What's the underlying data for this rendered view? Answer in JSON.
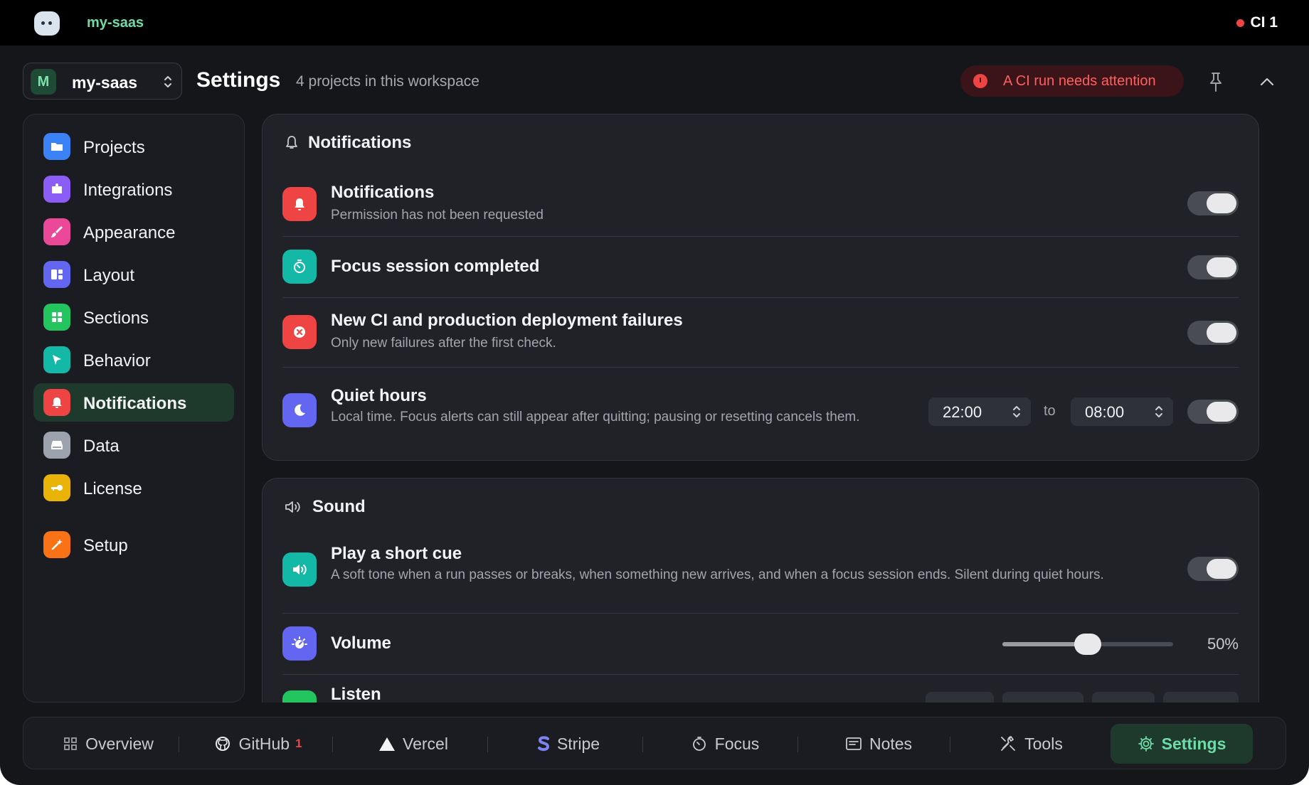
{
  "app": {
    "name": "my-saas",
    "ci_status": "CI 1"
  },
  "header": {
    "workspace_initial": "M",
    "workspace_name": "my-saas",
    "title": "Settings",
    "subtitle": "4 projects in this workspace",
    "alert_text": "A CI run needs attention"
  },
  "sidebar": {
    "items": [
      {
        "label": "Projects",
        "color": "#3b82f6",
        "icon": "folder-icon"
      },
      {
        "label": "Integrations",
        "color": "#8b5cf6",
        "icon": "puzzle-icon"
      },
      {
        "label": "Appearance",
        "color": "#ec4899",
        "icon": "brush-icon"
      },
      {
        "label": "Layout",
        "color": "#6366f1",
        "icon": "layout-icon"
      },
      {
        "label": "Sections",
        "color": "#22c55e",
        "icon": "grid-icon"
      },
      {
        "label": "Behavior",
        "color": "#14b8a6",
        "icon": "cursor-icon"
      },
      {
        "label": "Notifications",
        "color": "#ef4444",
        "icon": "bell-icon",
        "active": true
      },
      {
        "label": "Data",
        "color": "#9ca3af",
        "icon": "drive-icon"
      },
      {
        "label": "License",
        "color": "#eab308",
        "icon": "key-icon"
      },
      {
        "label": "Setup",
        "color": "#f97316",
        "icon": "wand-icon"
      }
    ]
  },
  "notifications_card": {
    "title": "Notifications",
    "rows": [
      {
        "title": "Notifications",
        "description": "Permission has not been requested",
        "color": "#ef4444",
        "icon": "bell-icon",
        "enabled": true
      },
      {
        "title": "Focus session completed",
        "description": "",
        "color": "#14b8a6",
        "icon": "timer-icon",
        "enabled": true
      },
      {
        "title": "New CI and production deployment failures",
        "description": "Only new failures after the first check.",
        "color": "#ef4444",
        "icon": "error-icon",
        "enabled": true
      },
      {
        "title": "Quiet hours",
        "description": "Local time. Focus alerts can still appear after quitting; pausing or resetting cancels them.",
        "color": "#6366f1",
        "icon": "moon-icon",
        "enabled": true
      }
    ],
    "quiet_hours": {
      "start": "22:00",
      "to_label": "to",
      "end": "08:00"
    }
  },
  "sound_card": {
    "title": "Sound",
    "rows": [
      {
        "title": "Play a short cue",
        "description": "A soft tone when a run passes or breaks, when something new arrives, and when a focus session ends. Silent during quiet hours.",
        "color": "#14b8a6",
        "icon": "speaker-icon",
        "enabled": true
      },
      {
        "title": "Volume",
        "color": "#6366f1",
        "icon": "dial-icon"
      },
      {
        "title": "Listen",
        "color": "#22c55e",
        "icon": "play-icon"
      }
    ],
    "volume": {
      "value": 0.5,
      "label": "50%"
    }
  },
  "tabs": [
    {
      "label": "Overview",
      "icon": "grid-icon"
    },
    {
      "label": "GitHub",
      "icon": "github-icon",
      "count": "1"
    },
    {
      "label": "Vercel",
      "icon": "triangle-icon"
    },
    {
      "label": "Stripe",
      "icon": "stripe-icon"
    },
    {
      "label": "Focus",
      "icon": "timer-icon"
    },
    {
      "label": "Notes",
      "icon": "notes-icon"
    },
    {
      "label": "Tools",
      "icon": "tools-icon"
    },
    {
      "label": "Settings",
      "icon": "gear-icon",
      "active": true
    }
  ]
}
